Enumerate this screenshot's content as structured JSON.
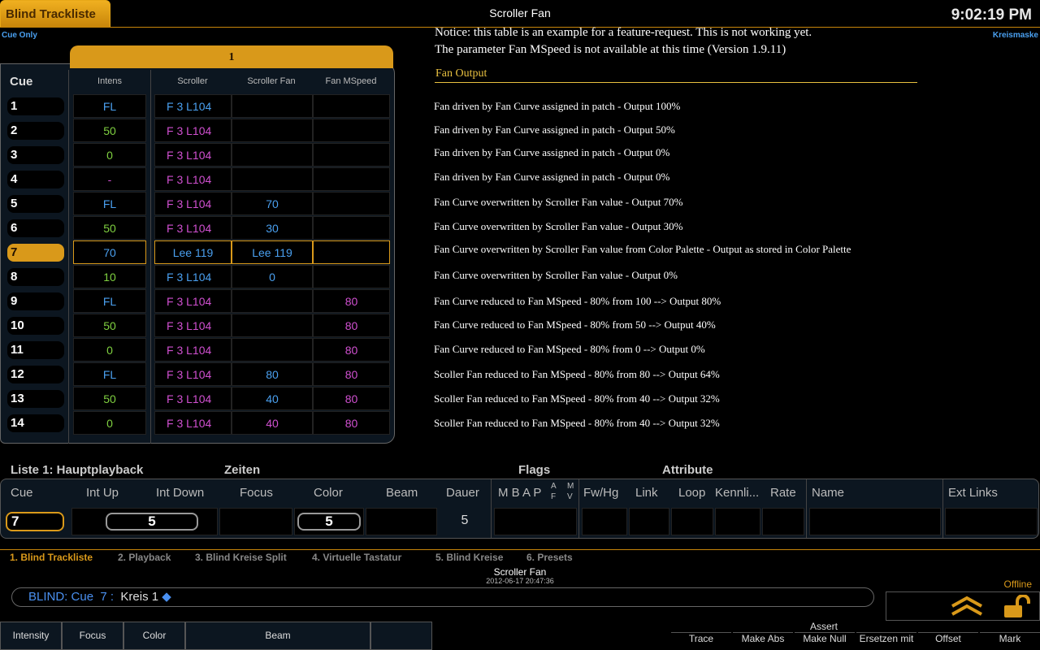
{
  "colors": {
    "accent": "#d9991a",
    "intens_fl": "#4aa0f0",
    "intens_green": "#7fd040",
    "intens_dash": "#d050d0",
    "scroller_magenta": "#d050d0",
    "scroller_blue": "#4aa0f0",
    "fan_blue": "#4aa0f0",
    "fan_magenta": "#d050d0",
    "mspeed": "#d050d0"
  },
  "header": {
    "tab_label": "Blind Trackliste",
    "center_title": "Scroller Fan",
    "clock": "9:02:19 PM",
    "cue_only": "Cue Only",
    "right_label": "Kreismaske"
  },
  "table": {
    "selection_header": "1",
    "cue_header": "Cue",
    "col_intens": "Intens",
    "col_scroller": "Scroller",
    "col_fan": "Scroller Fan",
    "col_mspeed": "Fan MSpeed",
    "rows": [
      {
        "cue": "1",
        "intens": "FL",
        "ic": "intens_fl",
        "scroller": "F 3 L104",
        "sc": "scroller_blue",
        "fan": "",
        "fc": "fan_blue",
        "msp": ""
      },
      {
        "cue": "2",
        "intens": "50",
        "ic": "intens_green",
        "scroller": "F 3 L104",
        "sc": "scroller_magenta",
        "fan": "",
        "fc": "fan_blue",
        "msp": ""
      },
      {
        "cue": "3",
        "intens": "0",
        "ic": "intens_green",
        "scroller": "F 3 L104",
        "sc": "scroller_magenta",
        "fan": "",
        "fc": "fan_blue",
        "msp": ""
      },
      {
        "cue": "4",
        "intens": "-",
        "ic": "intens_dash",
        "scroller": "F 3 L104",
        "sc": "scroller_magenta",
        "fan": "",
        "fc": "fan_blue",
        "msp": ""
      },
      {
        "cue": "5",
        "intens": "FL",
        "ic": "intens_fl",
        "scroller": "F 3 L104",
        "sc": "scroller_magenta",
        "fan": "70",
        "fc": "fan_blue",
        "msp": ""
      },
      {
        "cue": "6",
        "intens": "50",
        "ic": "intens_green",
        "scroller": "F 3 L104",
        "sc": "scroller_magenta",
        "fan": "30",
        "fc": "fan_blue",
        "msp": ""
      },
      {
        "cue": "7",
        "intens": "70",
        "ic": "intens_fl",
        "scroller": "Lee 119",
        "sc": "scroller_blue",
        "fan": "Lee 119",
        "fc": "fan_blue",
        "msp": "",
        "active": true
      },
      {
        "cue": "8",
        "intens": "10",
        "ic": "intens_green",
        "scroller": "F 3 L104",
        "sc": "scroller_blue",
        "fan": "0",
        "fc": "fan_blue",
        "msp": ""
      },
      {
        "cue": "9",
        "intens": "FL",
        "ic": "intens_fl",
        "scroller": "F 3 L104",
        "sc": "scroller_magenta",
        "fan": "",
        "fc": "fan_blue",
        "msp": "80"
      },
      {
        "cue": "10",
        "intens": "50",
        "ic": "intens_green",
        "scroller": "F 3 L104",
        "sc": "scroller_magenta",
        "fan": "",
        "fc": "fan_blue",
        "msp": "80"
      },
      {
        "cue": "11",
        "intens": "0",
        "ic": "intens_green",
        "scroller": "F 3 L104",
        "sc": "scroller_magenta",
        "fan": "",
        "fc": "fan_blue",
        "msp": "80"
      },
      {
        "cue": "12",
        "intens": "FL",
        "ic": "intens_fl",
        "scroller": "F 3 L104",
        "sc": "scroller_magenta",
        "fan": "80",
        "fc": "fan_blue",
        "msp": "80"
      },
      {
        "cue": "13",
        "intens": "50",
        "ic": "intens_green",
        "scroller": "F 3 L104",
        "sc": "scroller_magenta",
        "fan": "40",
        "fc": "fan_blue",
        "msp": "80"
      },
      {
        "cue": "14",
        "intens": "0",
        "ic": "intens_green",
        "scroller": "F 3 L104",
        "sc": "scroller_magenta",
        "fan": "40",
        "fc": "fan_magenta",
        "msp": "80"
      }
    ]
  },
  "notice": {
    "line1": "Notice: this table is an example for a feature-request.  This is not working yet.",
    "line2": "The parameter Fan MSpeed is not available at this time (Version 1.9.11)",
    "section": "Fan Output",
    "notes": [
      "Fan driven by Fan Curve assigned in patch - Output 100%",
      "Fan driven by Fan Curve assigned in patch - Output 50%",
      "Fan driven by Fan Curve assigned in patch - Output 0%",
      "Fan driven by Fan Curve assigned in patch - Output 0%",
      "Fan Curve overwritten by Scroller Fan value - Output 70%",
      "Fan Curve overwritten by Scroller Fan value - Output 30%",
      "Fan Curve overwritten by Scroller Fan value from Color Palette - Output as stored in Color Palette",
      "Fan Curve overwritten by Scroller Fan value - Output 0%",
      "Fan Curve reduced to Fan MSpeed - 80% from 100 --> Output 80%",
      "Fan Curve reduced to Fan MSpeed - 80% from 50 --> Output 40%",
      "Fan Curve reduced to Fan MSpeed - 80% from 0 --> Output 0%",
      "Scoller Fan reduced to Fan MSpeed - 80% from 80 --> Output 64%",
      "Scoller Fan reduced to Fan MSpeed - 80% from 40 --> Output 32%",
      "Scoller Fan reduced to Fan MSpeed - 80% from 40 --> Output 32%"
    ]
  },
  "cuelist": {
    "list_title": "Liste 1: Hauptplayback",
    "zeiten": "Zeiten",
    "flags": "Flags",
    "attribute": "Attribute",
    "h_cue": "Cue",
    "h_intup": "Int Up",
    "h_intdown": "Int Down",
    "h_focus": "Focus",
    "h_color": "Color",
    "h_beam": "Beam",
    "h_dauer": "Dauer",
    "h_flags": "M B A P",
    "h_af": "A F",
    "h_mv": "M V",
    "h_fwhg": "Fw/Hg",
    "h_link": "Link",
    "h_loop": "Loop",
    "h_kenn": "Kennli...",
    "h_rate": "Rate",
    "h_name": "Name",
    "h_ext": "Ext Links",
    "v_cue": "7",
    "v_intup": "5",
    "v_color": "5",
    "v_dauer": "5"
  },
  "tabs": [
    "1. Blind Trackliste",
    "2. Playback",
    "3. Blind Kreise Split",
    "4. Virtuelle Tastatur",
    "5. Blind Kreise",
    "6. Presets"
  ],
  "status": {
    "show": "Scroller Fan",
    "date": "2012-06-17 20:47:36",
    "offline": "Offline"
  },
  "cmdline": {
    "text": "BLIND: Cue  7 :  ",
    "kreis": "Kreis 1"
  },
  "softkeys": [
    "Intensity",
    "Focus",
    "Color",
    "Beam"
  ],
  "rightkeys": {
    "assert": "Assert",
    "keys": [
      "Trace",
      "Make Abs",
      "Make Null",
      "Ersetzen mit",
      "Offset",
      "Mark"
    ]
  }
}
